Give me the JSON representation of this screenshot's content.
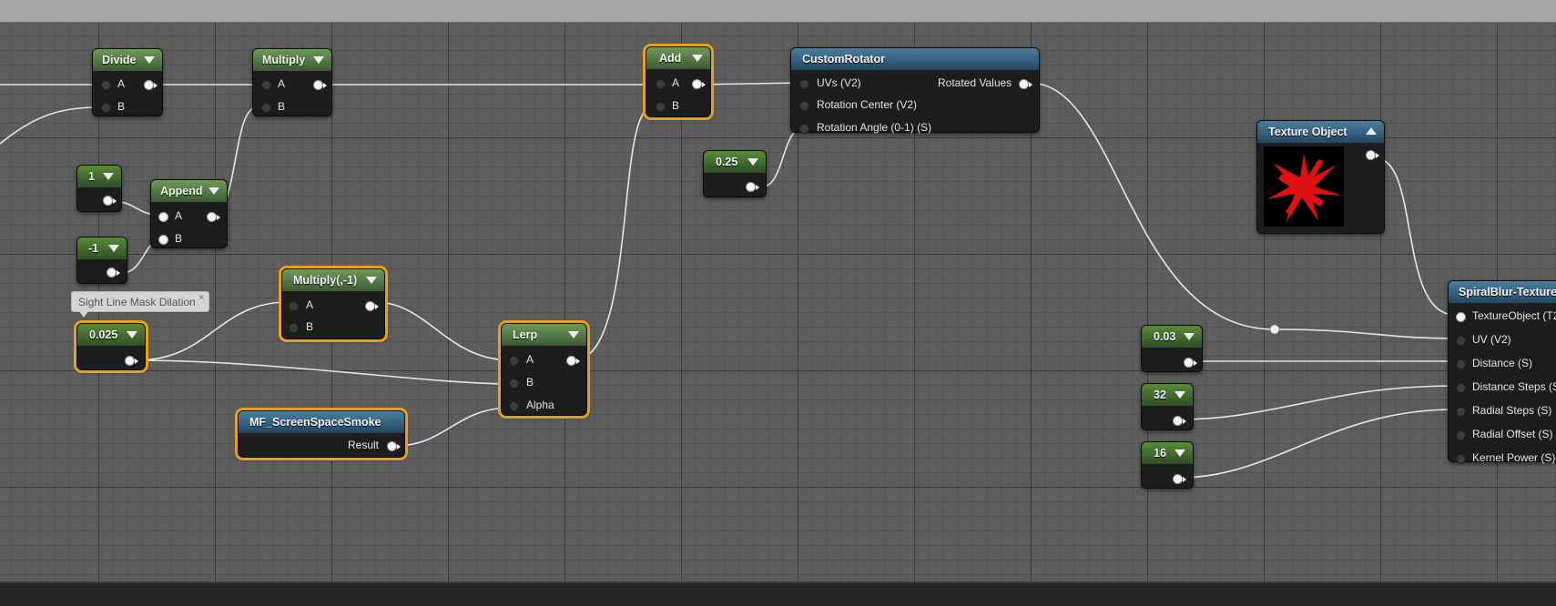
{
  "colors": {
    "selection": "#e8a11c",
    "wire": "#e6e6e6",
    "texture_preview": "#dd1111"
  },
  "nodes": {
    "divide": {
      "title": "Divide",
      "pin_a": "A",
      "pin_b": "B"
    },
    "multiply": {
      "title": "Multiply",
      "pin_a": "A",
      "pin_b": "B"
    },
    "const_1": {
      "title": "1"
    },
    "const_neg1": {
      "title": "-1"
    },
    "append": {
      "title": "Append",
      "pin_a": "A",
      "pin_b": "B"
    },
    "const_0025": {
      "title": "0.025",
      "comment": "Sight Line Mask Dilation"
    },
    "multiply_neg1": {
      "title": "Multiply(,-1)",
      "pin_a": "A",
      "pin_b": "B"
    },
    "lerp": {
      "title": "Lerp",
      "pin_a": "A",
      "pin_b": "B",
      "pin_alpha": "Alpha"
    },
    "mf_smoke": {
      "title": "MF_ScreenSpaceSmoke",
      "pin_result": "Result"
    },
    "add": {
      "title": "Add",
      "pin_a": "A",
      "pin_b": "B"
    },
    "const_025": {
      "title": "0.25"
    },
    "custom_rotator": {
      "title": "CustomRotator",
      "pin_uvs": "UVs (V2)",
      "pin_center": "Rotation Center (V2)",
      "pin_angle": "Rotation Angle (0-1) (S)",
      "pin_out": "Rotated Values"
    },
    "texture_object": {
      "title": "Texture Object"
    },
    "const_003": {
      "title": "0.03"
    },
    "const_32": {
      "title": "32"
    },
    "const_16": {
      "title": "16"
    },
    "spiral_blur": {
      "title": "SpiralBlur-Texture",
      "pins": [
        "TextureObject (T2",
        "UV (V2)",
        "Distance (S)",
        "Distance Steps (S",
        "Radial Steps (S)",
        "Radial Offset (S)",
        "Kernel Power (S)"
      ]
    }
  }
}
